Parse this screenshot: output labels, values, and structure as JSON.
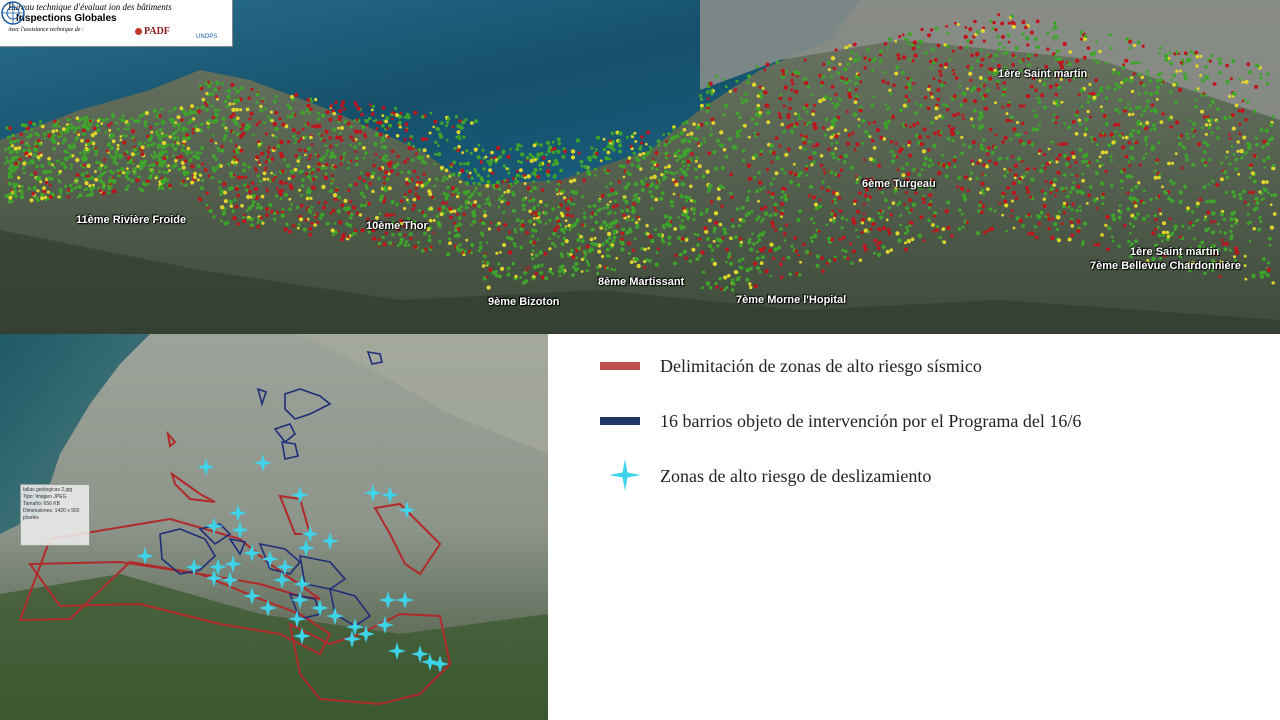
{
  "header": {
    "line1": "Bureau technique d'évaluat ion des bâtiments",
    "line2": "Inspections Globales",
    "line3": "Avec l'assistance technique de :",
    "padf_logo": "PADF",
    "unops_text": "UNOPS"
  },
  "top_map": {
    "labels": [
      "1ère Saint martin",
      "11ème Rivière Froide",
      "10ème Thor",
      "6ème Turgeau",
      "1ère Saint martin",
      "7ème Bellevue Chardonnière",
      "8ème Martissant",
      "9ème Bizoton",
      "7ème Morne l'Hopital"
    ],
    "colors": {
      "sea": "#1e5f7a",
      "land": "#5d6a55",
      "green_points": "#3ea52b",
      "red_points": "#c0141a",
      "yellow_points": "#e0d52a"
    }
  },
  "bottom_map": {
    "file_info": [
      "fallas geologicas 2.jpg",
      "Tipo: Imagen JPEG",
      "Tamaño: 656 KB",
      "Dimensiones: 1420 x 902",
      "píxeles"
    ],
    "colors": {
      "seismic_zone": "#b02a2a",
      "intervention_zone": "#1f2d7a",
      "landslide_marker": "#3fd3ea"
    }
  },
  "legend": {
    "items": [
      {
        "label": "Delimitación de zonas de alto riesgo sísmico",
        "color": "#c0504d",
        "icon": "red-line-swatch"
      },
      {
        "label": "16 barrios objeto de intervención por el Programa del 16/6",
        "color": "#1f3864",
        "icon": "dark-blue-line-swatch"
      },
      {
        "label": "Zonas de alto riesgo de deslizamiento",
        "color": "#3fd3ea",
        "icon": "cyan-star-marker"
      }
    ]
  }
}
